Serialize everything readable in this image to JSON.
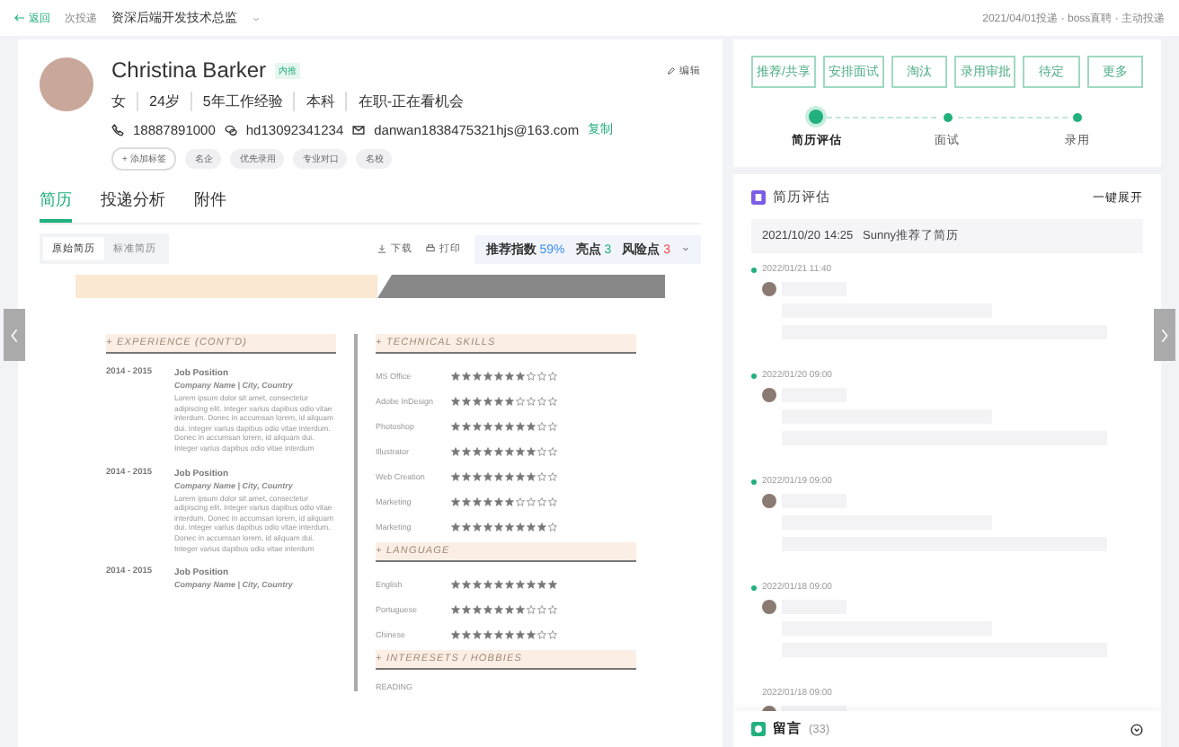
{
  "topbar": {
    "back": "返回",
    "count": "次投递",
    "position": "资深后端开发技术总监",
    "source": "2021/04/01投递 · boss直聘 · 主动投递"
  },
  "profile": {
    "name": "Christina Barker",
    "badge": "内推",
    "edit": "编辑",
    "facts": [
      "女",
      "24岁",
      "5年工作经验",
      "本科",
      "在职-正在看机会"
    ],
    "phone": "18887891000",
    "wechat": "hd13092341234",
    "email": "danwan1838475321hjs@163.com",
    "copy": "复制",
    "add_tag": "+ 添加标签",
    "tags": [
      "名企",
      "优先录用",
      "专业对口",
      "名校"
    ]
  },
  "tabs": [
    {
      "label": "简历",
      "selected": true
    },
    {
      "label": "投递分析",
      "selected": false
    },
    {
      "label": "附件",
      "selected": false
    }
  ],
  "toolbar": {
    "views": [
      {
        "label": "原始简历",
        "selected": true
      },
      {
        "label": "标准简历",
        "selected": false
      }
    ],
    "download": "下载",
    "print": "打印",
    "score_label": "推荐指数",
    "score": "59%",
    "highlights_label": "亮点",
    "highlights": "3",
    "risks_label": "风险点",
    "risks": "3"
  },
  "resume": {
    "experience_title": "+ EXPERIENCE (CONT'D)",
    "jobs": [
      {
        "years": "2014 - 2015",
        "title": "Job Position",
        "company": "Company Name | City, Country",
        "text": "Lorem ipsum dolor sit amet, consectetur adipiscing elit. Integer varius dapibus odio vitae interdum. Donec in accumsan lorem, id aliquam dui. Integer varius dapibus odio vitae interdum. Donec in accumsan lorem, id aliquam dui. Integer varius dapibus odio vitae interdum"
      },
      {
        "years": "2014 - 2015",
        "title": "Job Position",
        "company": "Company Name | City, Country",
        "text": "Lorem ipsum dolor sit amet, consectetur adipiscing elit. Integer varius dapibus odio vitae interdum. Donec in accumsan lorem, id aliquam dui. Integer varius dapibus odio vitae interdum. Donec in accumsan lorem, id aliquam dui. Integer varius dapibus odio vitae interdum"
      },
      {
        "years": "2014 - 2015",
        "title": "Job Position",
        "company": "Company Name | City, Country"
      }
    ],
    "skills_title": "+ TECHNICAL SKILLS",
    "skills": [
      {
        "name": "MS Office",
        "stars": 7
      },
      {
        "name": "Adobe InDesign",
        "stars": 6
      },
      {
        "name": "Photoshop",
        "stars": 8
      },
      {
        "name": "Illustrator",
        "stars": 8
      },
      {
        "name": "Web Creation",
        "stars": 8
      },
      {
        "name": "Marketing",
        "stars": 6
      },
      {
        "name": "Marketing",
        "stars": 9
      }
    ],
    "language_title": "+ LANGUAGE",
    "languages": [
      {
        "name": "English",
        "stars": 10
      },
      {
        "name": "Portuguese",
        "stars": 7
      },
      {
        "name": "Chinese",
        "stars": 8
      }
    ],
    "interests_title": "+ INTERESETS / HOBBIES",
    "interests": [
      "READING"
    ]
  },
  "actions": [
    "推荐/共享",
    "安排面试",
    "淘汰",
    "录用审批",
    "待定",
    "更多"
  ],
  "steps": [
    {
      "label": "简历评估",
      "current": true
    },
    {
      "label": "面试",
      "current": false
    },
    {
      "label": "录用",
      "current": false
    }
  ],
  "evaluation": {
    "title": "简历评估",
    "expand": "一键展开",
    "summary": "2021/10/20 14:25   Sunny推荐了简历",
    "entries": [
      {
        "time": "2022/01/21 11:40",
        "marked": true
      },
      {
        "time": "2022/01/20 09:00",
        "marked": true
      },
      {
        "time": "2022/01/19 09:00",
        "marked": true
      },
      {
        "time": "2022/01/18 09:00",
        "marked": true
      },
      {
        "time": "2022/01/18 09:00",
        "marked": false
      }
    ]
  },
  "comments": {
    "label": "留言",
    "count": "(33)"
  }
}
